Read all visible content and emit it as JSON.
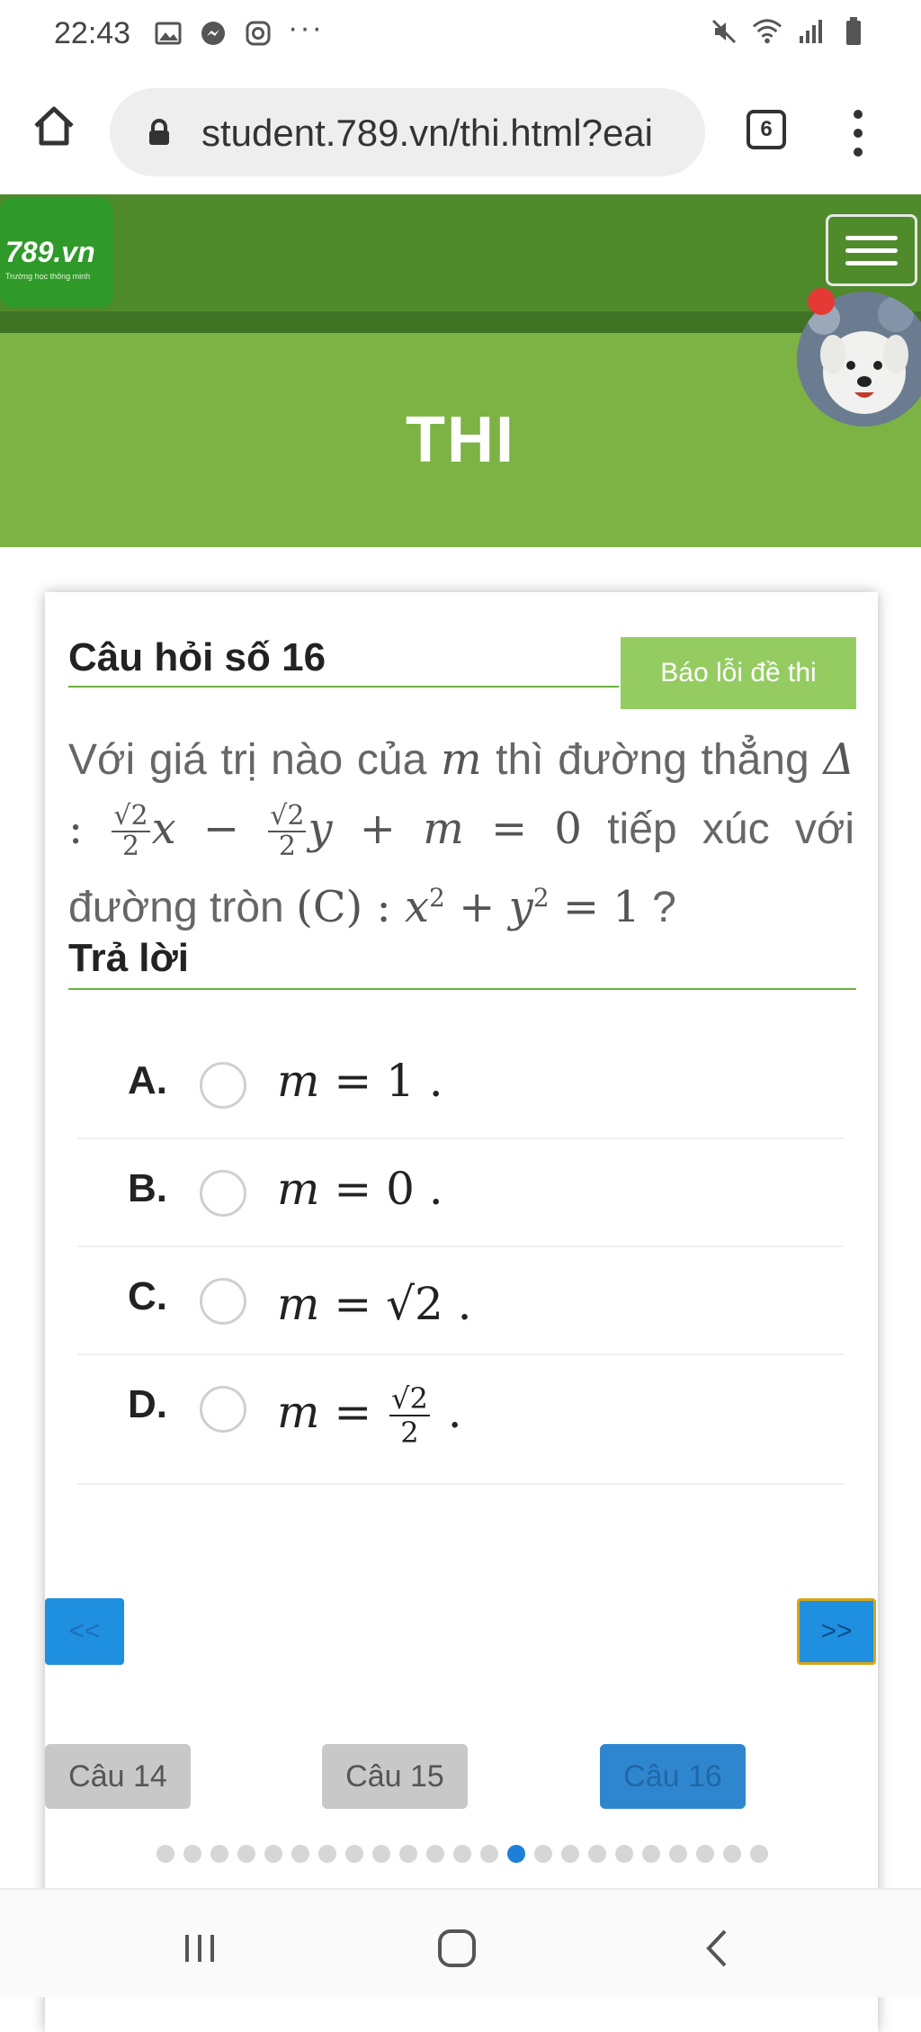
{
  "status_bar": {
    "time": "22:43",
    "dots": "···",
    "icons_left": [
      "image-icon",
      "messenger-icon",
      "instagram-icon"
    ],
    "icons_right": [
      "mute-icon",
      "wifi-icon",
      "signal-icon",
      "battery-icon"
    ]
  },
  "browser": {
    "url": "student.789.vn/thi.html?eai",
    "tab_count": "6"
  },
  "site": {
    "logo_text": "789.vn",
    "logo_sub": "Trường học thông minh",
    "page_title": "THI",
    "brand_green": "#4f8a2b",
    "hero_green": "#7db244"
  },
  "question": {
    "title": "Câu hỏi số 16",
    "report_label": "Báo lỗi đề thi",
    "text_part1": "Với giá trị nào của",
    "var_m": "m",
    "text_part2": "thì đường thẳng",
    "delta": "Δ",
    "colon": " : ",
    "sqrt2": "√2",
    "two": "2",
    "x": "x",
    "minus": " − ",
    "y": "y",
    "plus_m": " + ",
    "eq0": " = 0",
    "text_part3": "tiếp xúc với đường tròn",
    "circle_label": "(C)",
    "circle_eq_lhs": " : ",
    "x2": "x",
    "sup2": "2",
    "plus": " + ",
    "y2": "y",
    "eq1": " = 1",
    "qmark": " ?"
  },
  "answer": {
    "title": "Trả lời",
    "options": [
      {
        "letter": "A.",
        "expr_m": "m",
        "expr_rest": " = 1 ."
      },
      {
        "letter": "B.",
        "expr_m": "m",
        "expr_rest": " = 0 ."
      },
      {
        "letter": "C.",
        "expr_m": "m",
        "expr_rest": " = √2 ."
      },
      {
        "letter": "D.",
        "expr_m": "m",
        "expr_eq": " = ",
        "frac_num": "√2",
        "frac_den": "2",
        "expr_end": " ."
      }
    ]
  },
  "navigation": {
    "prev_label": "<<",
    "next_label": ">>",
    "questions": [
      "Câu 14",
      "Câu 15",
      "Câu 16"
    ],
    "current_question": "Câu 16",
    "dots_total": 23,
    "dots_active_index": 13
  }
}
